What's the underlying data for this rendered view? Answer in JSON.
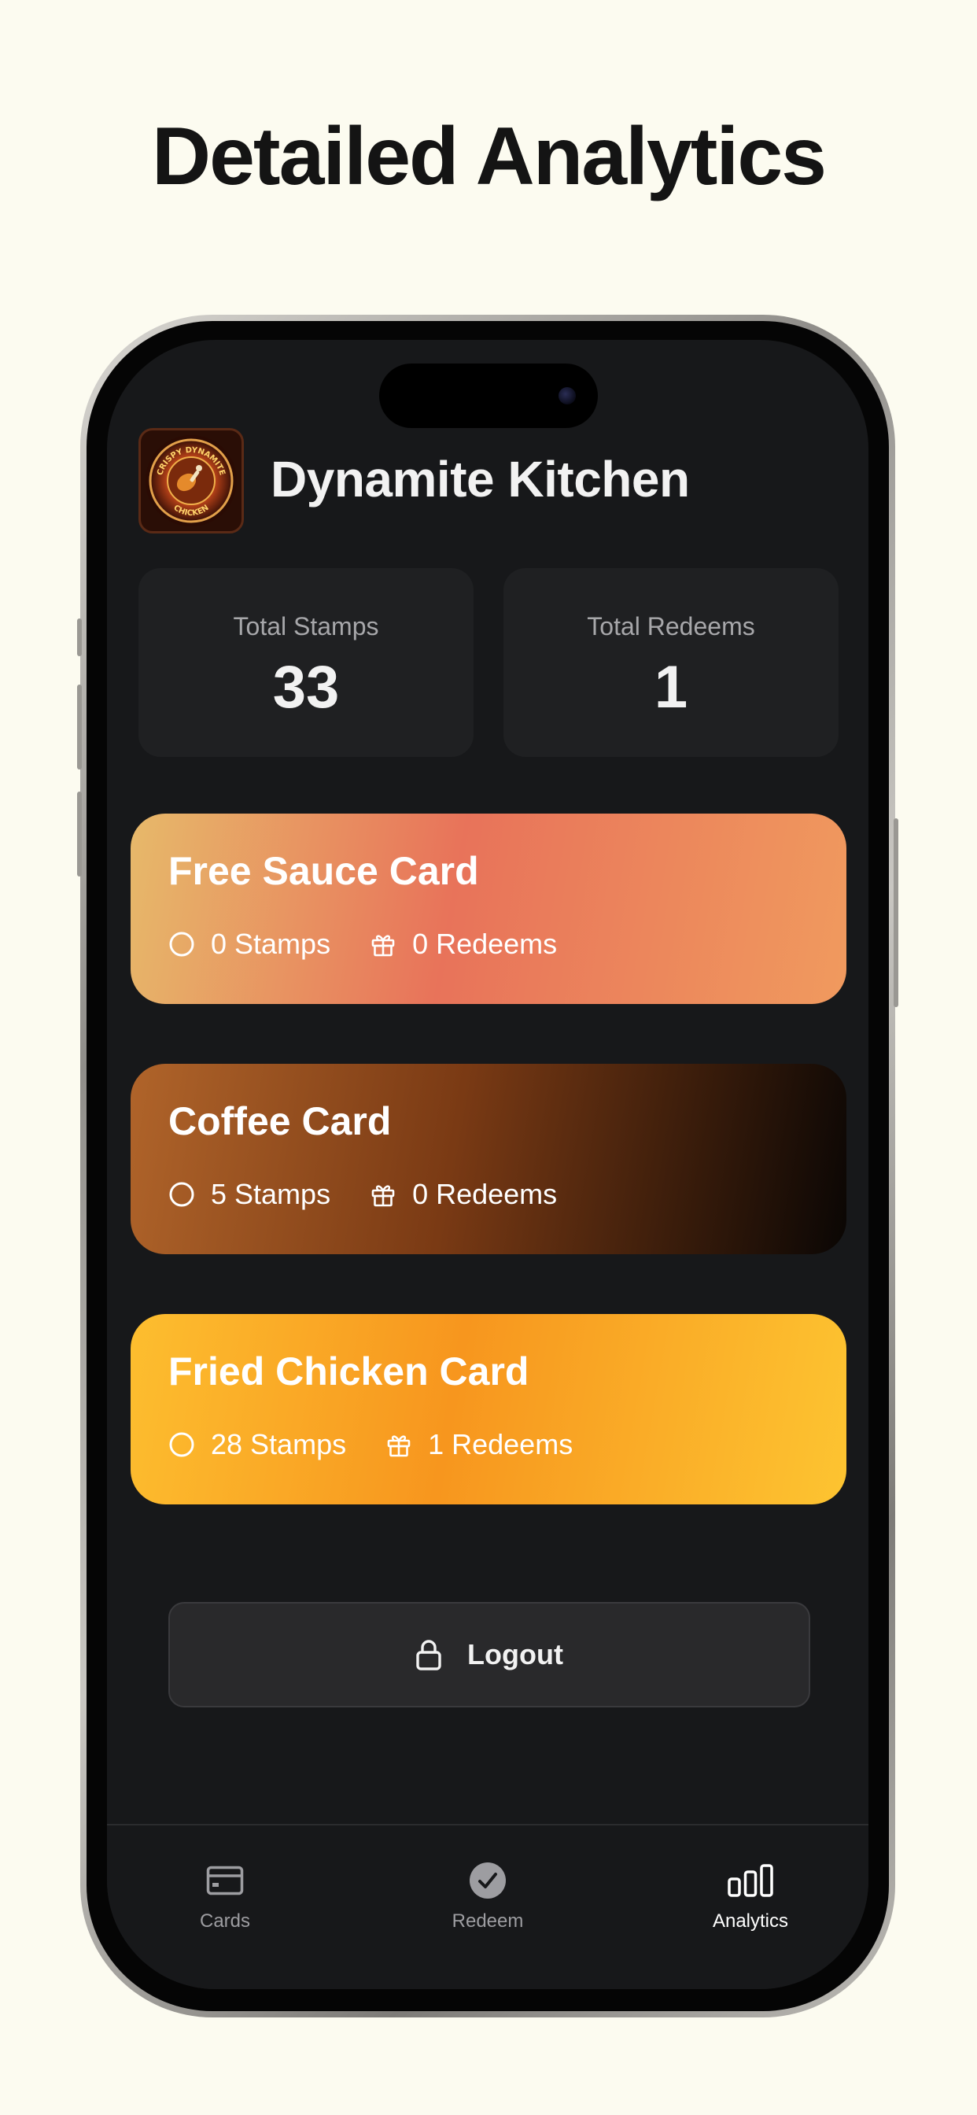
{
  "headline": "Detailed Analytics",
  "colors": {
    "page_background": "#FCFBF0",
    "screen_background": "#17181A",
    "tile_background": "#1F2022",
    "active_tab": "#FFFFFF",
    "inactive_tab": "#9D9DA1"
  },
  "header": {
    "title": "Dynamite Kitchen",
    "logo": {
      "icon": "crispy-dynamite-chicken-logo",
      "text_top": "CRISPY DYNAMITE",
      "text_bottom": "CHICKEN"
    }
  },
  "stats": [
    {
      "label": "Total Stamps",
      "value": "33"
    },
    {
      "label": "Total Redeems",
      "value": "1"
    }
  ],
  "cards": [
    {
      "title": "Free Sauce Card",
      "stamps": "0 Stamps",
      "redeems": "0 Redeems",
      "gradient": [
        "#E7B96A",
        "#E8735A",
        "#F09A5E"
      ]
    },
    {
      "title": "Coffee Card",
      "stamps": "5 Stamps",
      "redeems": "0 Redeems",
      "gradient": [
        "#B0642A",
        "#7A3A14",
        "#0A0604"
      ]
    },
    {
      "title": "Fried Chicken Card",
      "stamps": "28 Stamps",
      "redeems": "1 Redeems",
      "gradient": [
        "#FDBE2F",
        "#F7961E",
        "#FDC431"
      ]
    }
  ],
  "logout": {
    "label": "Logout",
    "icon": "lock-icon"
  },
  "tabs": [
    {
      "label": "Cards",
      "icon": "card-icon",
      "active": false
    },
    {
      "label": "Redeem",
      "icon": "check-circle-icon",
      "active": false
    },
    {
      "label": "Analytics",
      "icon": "bar-chart-icon",
      "active": true
    }
  ]
}
